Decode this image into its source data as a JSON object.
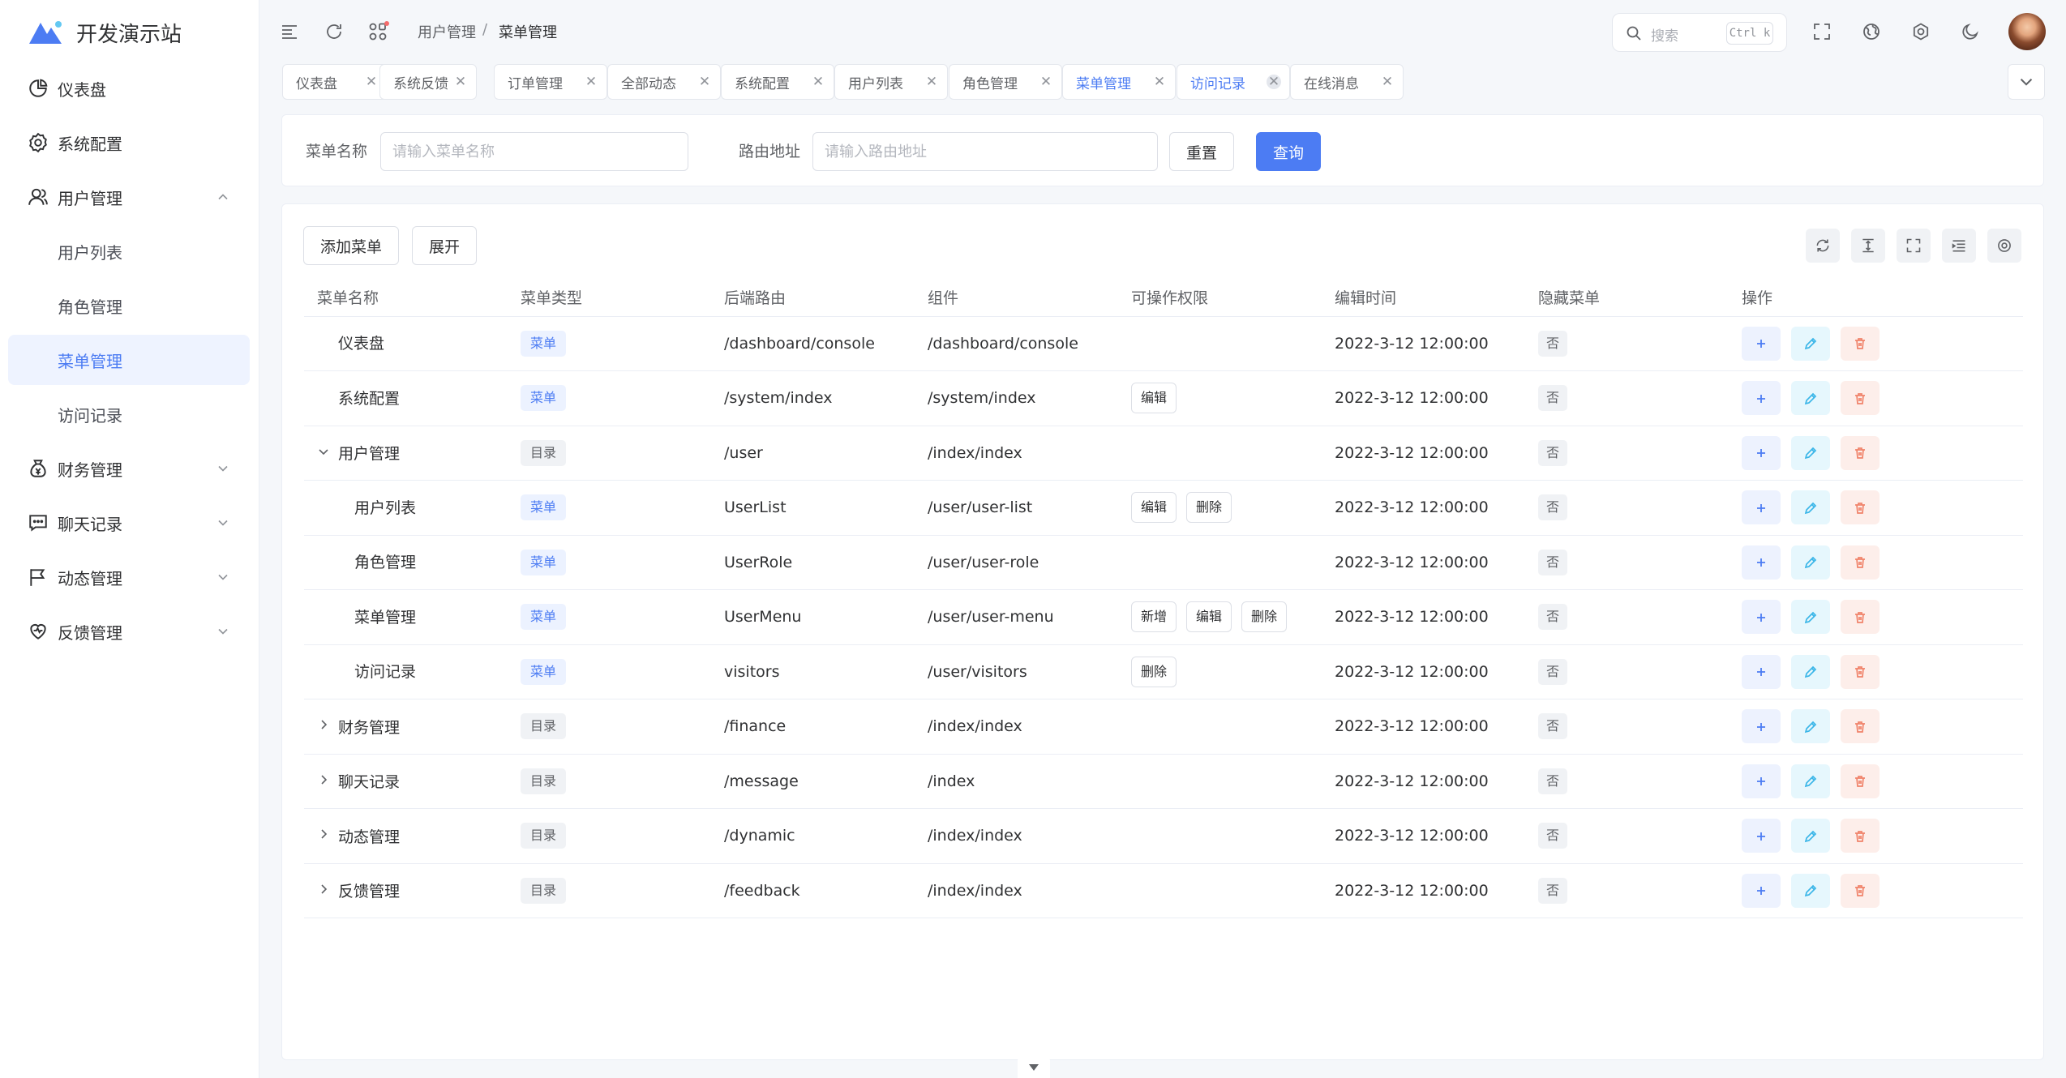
{
  "app": {
    "title": "开发演示站"
  },
  "sidebar": {
    "items": [
      {
        "label": "仪表盘",
        "icon": "pie-chart-icon"
      },
      {
        "label": "系统配置",
        "icon": "gear-icon"
      },
      {
        "label": "用户管理",
        "icon": "user-icon",
        "expanded": true
      },
      {
        "label": "用户列表"
      },
      {
        "label": "角色管理"
      },
      {
        "label": "菜单管理",
        "active": true
      },
      {
        "label": "访问记录"
      },
      {
        "label": "财务管理",
        "icon": "money-bag-icon"
      },
      {
        "label": "聊天记录",
        "icon": "chat-icon"
      },
      {
        "label": "动态管理",
        "icon": "flag-icon"
      },
      {
        "label": "反馈管理",
        "icon": "heart-icon"
      }
    ]
  },
  "header": {
    "breadcrumb": [
      "用户管理",
      "菜单管理"
    ],
    "breadcrumb_sep": "/",
    "search_placeholder": "搜索",
    "search_shortcut": "Ctrl k"
  },
  "tabs": [
    {
      "label": "仪表盘"
    },
    {
      "label": "系统反馈"
    },
    {
      "label": "订单管理"
    },
    {
      "label": "全部动态"
    },
    {
      "label": "系统配置"
    },
    {
      "label": "用户列表"
    },
    {
      "label": "角色管理"
    },
    {
      "label": "菜单管理",
      "active": true
    },
    {
      "label": "访问记录",
      "active": true
    },
    {
      "label": "在线消息"
    }
  ],
  "search_form": {
    "name_label": "菜单名称",
    "name_placeholder": "请输入菜单名称",
    "route_label": "路由地址",
    "route_placeholder": "请输入路由地址",
    "reset_label": "重置",
    "query_label": "查询"
  },
  "toolbar": {
    "add_label": "添加菜单",
    "expand_label": "展开"
  },
  "table": {
    "columns": [
      "菜单名称",
      "菜单类型",
      "后端路由",
      "组件",
      "可操作权限",
      "编辑时间",
      "隐藏菜单",
      "操作"
    ],
    "rows": [
      {
        "name": "仪表盘",
        "type": "菜单",
        "route": "/dashboard/console",
        "component": "/dashboard/console",
        "perms": [],
        "time": "2022-3-12 12:00:00",
        "hidden": "否"
      },
      {
        "name": "系统配置",
        "type": "菜单",
        "route": "/system/index",
        "component": "/system/index",
        "perms": [
          "编辑"
        ],
        "time": "2022-3-12 12:00:00",
        "hidden": "否"
      },
      {
        "name": "用户管理",
        "type": "目录",
        "route": "/user",
        "component": "/index/index",
        "perms": [],
        "time": "2022-3-12 12:00:00",
        "hidden": "否",
        "expandable": true,
        "expanded": true
      },
      {
        "name": "用户列表",
        "type": "菜单",
        "route": "UserList",
        "component": "/user/user-list",
        "perms": [
          "编辑",
          "删除"
        ],
        "time": "2022-3-12 12:00:00",
        "hidden": "否",
        "child": true
      },
      {
        "name": "角色管理",
        "type": "菜单",
        "route": "UserRole",
        "component": "/user/user-role",
        "perms": [],
        "time": "2022-3-12 12:00:00",
        "hidden": "否",
        "child": true
      },
      {
        "name": "菜单管理",
        "type": "菜单",
        "route": "UserMenu",
        "component": "/user/user-menu",
        "perms": [
          "新增",
          "编辑",
          "删除"
        ],
        "time": "2022-3-12 12:00:00",
        "hidden": "否",
        "child": true
      },
      {
        "name": "访问记录",
        "type": "菜单",
        "route": "visitors",
        "component": "/user/visitors",
        "perms": [
          "删除"
        ],
        "time": "2022-3-12 12:00:00",
        "hidden": "否",
        "child": true
      },
      {
        "name": "财务管理",
        "type": "目录",
        "route": "/finance",
        "component": "/index/index",
        "perms": [],
        "time": "2022-3-12 12:00:00",
        "hidden": "否",
        "expandable": true
      },
      {
        "name": "聊天记录",
        "type": "目录",
        "route": "/message",
        "component": "/index",
        "perms": [],
        "time": "2022-3-12 12:00:00",
        "hidden": "否",
        "expandable": true
      },
      {
        "name": "动态管理",
        "type": "目录",
        "route": "/dynamic",
        "component": "/index/index",
        "perms": [],
        "time": "2022-3-12 12:00:00",
        "hidden": "否",
        "expandable": true
      },
      {
        "name": "反馈管理",
        "type": "目录",
        "route": "/feedback",
        "component": "/index/index",
        "perms": [],
        "time": "2022-3-12 12:00:00",
        "hidden": "否",
        "expandable": true
      }
    ]
  },
  "colors": {
    "primary": "#4c7cf3",
    "edit": "#3bb6e8",
    "danger": "#f0836a"
  }
}
